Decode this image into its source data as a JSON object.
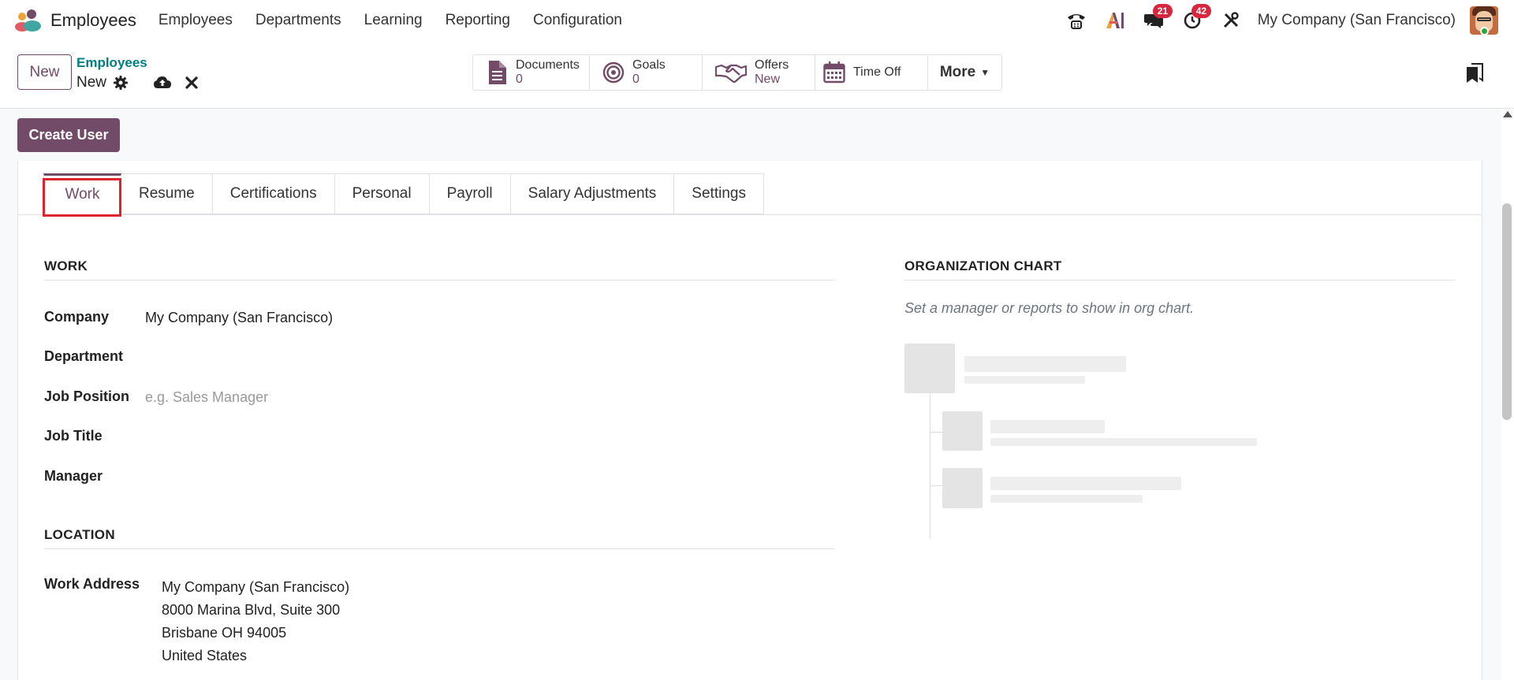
{
  "navbar": {
    "app_name": "Employees",
    "menu": [
      "Employees",
      "Departments",
      "Learning",
      "Reporting",
      "Configuration"
    ],
    "messages_count": "21",
    "activities_count": "42",
    "company": "My Company (San Francisco)"
  },
  "control_panel": {
    "new_button": "New",
    "breadcrumb_parent": "Employees",
    "breadcrumb_current": "New",
    "smart_buttons": {
      "documents": {
        "label": "Documents",
        "value": "0"
      },
      "goals": {
        "label": "Goals",
        "value": "0"
      },
      "offers": {
        "label": "Offers",
        "value": "New"
      },
      "time_off": {
        "label": "Time Off"
      },
      "more": "More"
    }
  },
  "status_bar": {
    "create_user_button": "Create User"
  },
  "tabs": [
    "Work",
    "Resume",
    "Certifications",
    "Personal",
    "Payroll",
    "Salary Adjustments",
    "Settings"
  ],
  "work_section": {
    "title": "WORK",
    "company_label": "Company",
    "company_value": "My Company (San Francisco)",
    "department_label": "Department",
    "job_position_label": "Job Position",
    "job_position_placeholder": "e.g. Sales Manager",
    "job_title_label": "Job Title",
    "manager_label": "Manager"
  },
  "location_section": {
    "title": "LOCATION",
    "work_address_label": "Work Address",
    "address_lines": [
      "My Company (San Francisco)",
      "8000 Marina Blvd, Suite 300",
      "Brisbane OH 94005",
      "United States"
    ]
  },
  "org_chart": {
    "title": "ORGANIZATION CHART",
    "hint": "Set a manager or reports to show in org chart."
  },
  "colors": {
    "primary": "#714b67",
    "link": "#017e84",
    "badge": "#d7263d",
    "highlight": "#e0242d"
  }
}
